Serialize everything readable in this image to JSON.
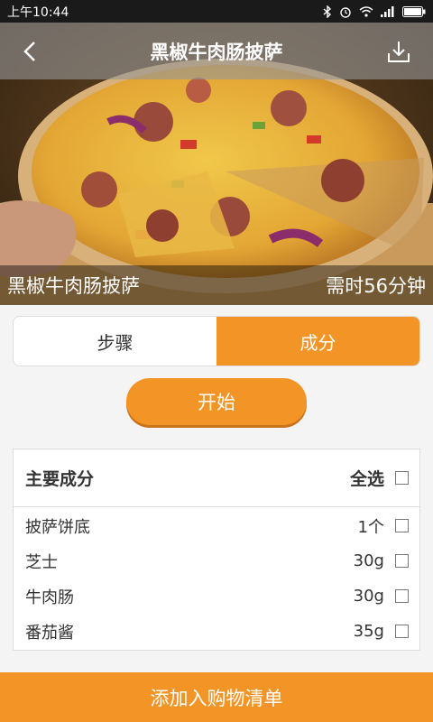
{
  "status_bar": {
    "time": "上午10:44"
  },
  "header": {
    "title": "黑椒牛肉肠披萨",
    "back_icon": "back-chevron-icon",
    "download_icon": "download-icon"
  },
  "hero": {
    "dish_name": "黑椒牛肉肠披萨",
    "duration": "需时56分钟"
  },
  "tabs": {
    "steps": "步骤",
    "ingredients": "成分",
    "active": "ingredients"
  },
  "start_button": "开始",
  "ingredients": {
    "heading": "主要成分",
    "select_all": "全选",
    "items": [
      {
        "name": "披萨饼底",
        "qty": "1个"
      },
      {
        "name": "芝士",
        "qty": "30g"
      },
      {
        "name": "牛肉肠",
        "qty": "30g"
      },
      {
        "name": "番茄酱",
        "qty": "35g"
      }
    ]
  },
  "cart_button": "添加入购物清单",
  "colors": {
    "accent": "#f39526",
    "statusbar": "#1a1a1a"
  }
}
